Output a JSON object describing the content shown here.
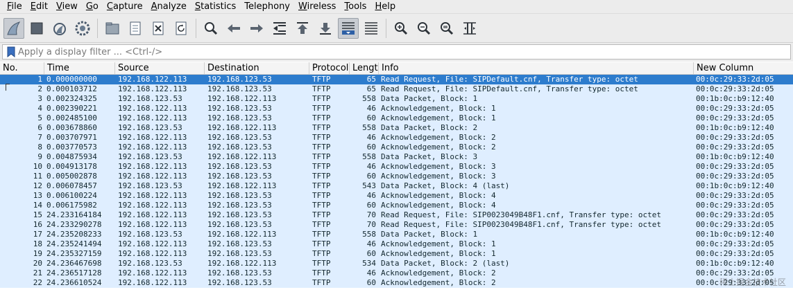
{
  "menu": [
    {
      "key": "F",
      "rest": "ile"
    },
    {
      "key": "E",
      "rest": "dit"
    },
    {
      "key": "V",
      "rest": "iew"
    },
    {
      "key": "G",
      "rest": "o"
    },
    {
      "key": "C",
      "rest": "apture"
    },
    {
      "key": "A",
      "rest": "nalyze"
    },
    {
      "key": "S",
      "rest": "tatistics"
    },
    {
      "key": "",
      "rest": "Telephony"
    },
    {
      "key": "W",
      "rest": "ireless"
    },
    {
      "key": "T",
      "rest": "ools"
    },
    {
      "key": "H",
      "rest": "elp"
    }
  ],
  "toolbar": {
    "icons": [
      "shark-fin-start-icon",
      "stop-square-icon",
      "restart-fin-icon",
      "capture-options-gear-icon",
      "open-file-icon",
      "save-file-icon",
      "close-file-icon",
      "reload-file-icon",
      "find-packet-icon",
      "go-back-arrow-icon",
      "go-forward-arrow-icon",
      "go-to-packet-icon",
      "go-first-icon",
      "go-last-icon",
      "autoscroll-icon",
      "colorize-icon",
      "zoom-in-icon",
      "zoom-out-icon",
      "zoom-normal-icon",
      "resize-columns-icon"
    ]
  },
  "filter": {
    "placeholder": "Apply a display filter ... <Ctrl-/>"
  },
  "columns": {
    "no": "No.",
    "time": "Time",
    "source": "Source",
    "destination": "Destination",
    "protocol": "Protocol",
    "length": "Length",
    "info": "Info",
    "new_column": "New Column"
  },
  "selected_row": 1,
  "packets": [
    {
      "no": "1",
      "time": "0.000000000",
      "src": "192.168.122.113",
      "dst": "192.168.123.53",
      "proto": "TFTP",
      "len": "65",
      "info": "Read Request, File: SIPDefault.cnf, Transfer type: octet",
      "newcol": "00:0c:29:33:2d:05"
    },
    {
      "no": "2",
      "time": "0.000103712",
      "src": "192.168.122.113",
      "dst": "192.168.123.53",
      "proto": "TFTP",
      "len": "65",
      "info": "Read Request, File: SIPDefault.cnf, Transfer type: octet",
      "newcol": "00:0c:29:33:2d:05"
    },
    {
      "no": "3",
      "time": "0.002324325",
      "src": "192.168.123.53",
      "dst": "192.168.122.113",
      "proto": "TFTP",
      "len": "558",
      "info": "Data Packet, Block: 1",
      "newcol": "00:1b:0c:b9:12:40"
    },
    {
      "no": "4",
      "time": "0.002390221",
      "src": "192.168.122.113",
      "dst": "192.168.123.53",
      "proto": "TFTP",
      "len": "46",
      "info": "Acknowledgement, Block: 1",
      "newcol": "00:0c:29:33:2d:05"
    },
    {
      "no": "5",
      "time": "0.002485100",
      "src": "192.168.122.113",
      "dst": "192.168.123.53",
      "proto": "TFTP",
      "len": "60",
      "info": "Acknowledgement, Block: 1",
      "newcol": "00:0c:29:33:2d:05"
    },
    {
      "no": "6",
      "time": "0.003678860",
      "src": "192.168.123.53",
      "dst": "192.168.122.113",
      "proto": "TFTP",
      "len": "558",
      "info": "Data Packet, Block: 2",
      "newcol": "00:1b:0c:b9:12:40"
    },
    {
      "no": "7",
      "time": "0.003707971",
      "src": "192.168.122.113",
      "dst": "192.168.123.53",
      "proto": "TFTP",
      "len": "46",
      "info": "Acknowledgement, Block: 2",
      "newcol": "00:0c:29:33:2d:05"
    },
    {
      "no": "8",
      "time": "0.003770573",
      "src": "192.168.122.113",
      "dst": "192.168.123.53",
      "proto": "TFTP",
      "len": "60",
      "info": "Acknowledgement, Block: 2",
      "newcol": "00:0c:29:33:2d:05"
    },
    {
      "no": "9",
      "time": "0.004875934",
      "src": "192.168.123.53",
      "dst": "192.168.122.113",
      "proto": "TFTP",
      "len": "558",
      "info": "Data Packet, Block: 3",
      "newcol": "00:1b:0c:b9:12:40"
    },
    {
      "no": "10",
      "time": "0.004913178",
      "src": "192.168.122.113",
      "dst": "192.168.123.53",
      "proto": "TFTP",
      "len": "46",
      "info": "Acknowledgement, Block: 3",
      "newcol": "00:0c:29:33:2d:05"
    },
    {
      "no": "11",
      "time": "0.005002878",
      "src": "192.168.122.113",
      "dst": "192.168.123.53",
      "proto": "TFTP",
      "len": "60",
      "info": "Acknowledgement, Block: 3",
      "newcol": "00:0c:29:33:2d:05"
    },
    {
      "no": "12",
      "time": "0.006078457",
      "src": "192.168.123.53",
      "dst": "192.168.122.113",
      "proto": "TFTP",
      "len": "543",
      "info": "Data Packet, Block: 4 (last)",
      "newcol": "00:1b:0c:b9:12:40"
    },
    {
      "no": "13",
      "time": "0.006100224",
      "src": "192.168.122.113",
      "dst": "192.168.123.53",
      "proto": "TFTP",
      "len": "46",
      "info": "Acknowledgement, Block: 4",
      "newcol": "00:0c:29:33:2d:05"
    },
    {
      "no": "14",
      "time": "0.006175982",
      "src": "192.168.122.113",
      "dst": "192.168.123.53",
      "proto": "TFTP",
      "len": "60",
      "info": "Acknowledgement, Block: 4",
      "newcol": "00:0c:29:33:2d:05"
    },
    {
      "no": "15",
      "time": "24.233164184",
      "src": "192.168.122.113",
      "dst": "192.168.123.53",
      "proto": "TFTP",
      "len": "70",
      "info": "Read Request, File: SIP0023049B48F1.cnf, Transfer type: octet",
      "newcol": "00:0c:29:33:2d:05"
    },
    {
      "no": "16",
      "time": "24.233290278",
      "src": "192.168.122.113",
      "dst": "192.168.123.53",
      "proto": "TFTP",
      "len": "70",
      "info": "Read Request, File: SIP0023049B48F1.cnf, Transfer type: octet",
      "newcol": "00:0c:29:33:2d:05"
    },
    {
      "no": "17",
      "time": "24.235208233",
      "src": "192.168.123.53",
      "dst": "192.168.122.113",
      "proto": "TFTP",
      "len": "558",
      "info": "Data Packet, Block: 1",
      "newcol": "00:1b:0c:b9:12:40"
    },
    {
      "no": "18",
      "time": "24.235241494",
      "src": "192.168.122.113",
      "dst": "192.168.123.53",
      "proto": "TFTP",
      "len": "46",
      "info": "Acknowledgement, Block: 1",
      "newcol": "00:0c:29:33:2d:05"
    },
    {
      "no": "19",
      "time": "24.235327159",
      "src": "192.168.122.113",
      "dst": "192.168.123.53",
      "proto": "TFTP",
      "len": "60",
      "info": "Acknowledgement, Block: 1",
      "newcol": "00:0c:29:33:2d:05"
    },
    {
      "no": "20",
      "time": "24.236467698",
      "src": "192.168.123.53",
      "dst": "192.168.122.113",
      "proto": "TFTP",
      "len": "534",
      "info": "Data Packet, Block: 2 (last)",
      "newcol": "00:1b:0c:b9:12:40"
    },
    {
      "no": "21",
      "time": "24.236517128",
      "src": "192.168.122.113",
      "dst": "192.168.123.53",
      "proto": "TFTP",
      "len": "46",
      "info": "Acknowledgement, Block: 2",
      "newcol": "00:0c:29:33:2d:05"
    },
    {
      "no": "22",
      "time": "24.236610524",
      "src": "192.168.122.113",
      "dst": "192.168.123.53",
      "proto": "TFTP",
      "len": "60",
      "info": "Acknowledgement, Block: 2",
      "newcol": "00:0c:29:33:2d:05"
    }
  ],
  "colors": {
    "row_bg": "#dfeeff",
    "selected_bg": "#2d7ccd",
    "row_text": "#12272e"
  }
}
